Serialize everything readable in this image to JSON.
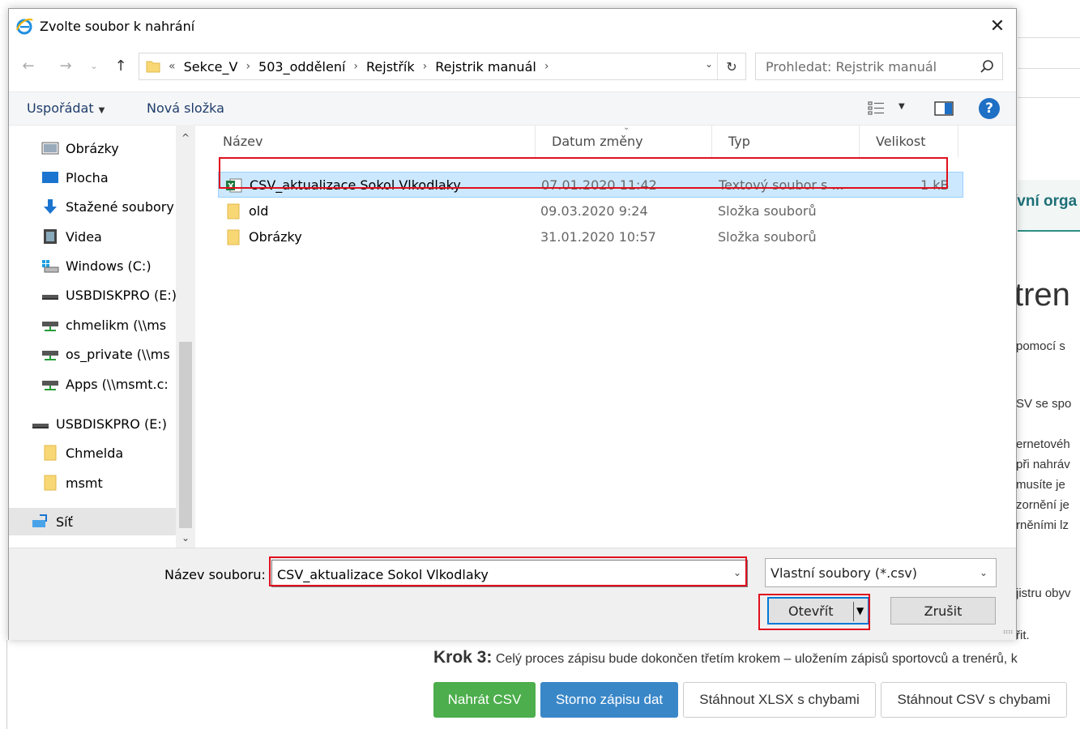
{
  "dialog": {
    "title": "Zvolte soubor k nahrání",
    "close": "✕",
    "breadcrumb": {
      "overflow": "«",
      "items": [
        "Sekce_V",
        "503_oddělení",
        "Rejstřík",
        "Rejstrik manuál"
      ]
    },
    "search_placeholder": "Prohledat: Rejstrik manuál",
    "toolbar": {
      "organize": "Uspořádat",
      "new_folder": "Nová složka"
    },
    "tree": [
      {
        "label": "Obrázky",
        "icon": "pictures-icon"
      },
      {
        "label": "Plocha",
        "icon": "desktop-icon"
      },
      {
        "label": "Stažené soubory",
        "icon": "download-icon"
      },
      {
        "label": "Videa",
        "icon": "video-icon"
      },
      {
        "label": "Windows (C:)",
        "icon": "windows-drive-icon"
      },
      {
        "label": "USBDISKPRO (E:)",
        "icon": "drive-icon"
      },
      {
        "label": "chmelikm (\\\\ms",
        "icon": "network-drive-icon"
      },
      {
        "label": "os_private (\\\\ms",
        "icon": "network-drive-icon"
      },
      {
        "label": "Apps (\\\\msmt.c:",
        "icon": "network-drive-icon"
      },
      {
        "label": "USBDISKPRO (E:)",
        "icon": "drive-icon"
      },
      {
        "label": "Chmelda",
        "icon": "folder-icon"
      },
      {
        "label": "msmt",
        "icon": "folder-icon"
      },
      {
        "label": "Síť",
        "icon": "network-icon"
      }
    ],
    "columns": {
      "name": "Název",
      "date": "Datum změny",
      "type": "Typ",
      "size": "Velikost"
    },
    "files": [
      {
        "name": "CSV_aktualizace Sokol Vlkodlaky",
        "date": "07.01.2020 11:42",
        "type": "Textový soubor s ...",
        "size": "1 kB",
        "icon": "excel-csv-icon"
      },
      {
        "name": "old",
        "date": "09.03.2020 9:24",
        "type": "Složka souborů",
        "size": "",
        "icon": "folder-icon"
      },
      {
        "name": "Obrázky",
        "date": "31.01.2020 10:57",
        "type": "Složka souborů",
        "size": "",
        "icon": "folder-icon"
      }
    ],
    "filename_label": "Název souboru:",
    "filename_value": "CSV_aktualizace Sokol Vlkodlaky",
    "filter_value": "Vlastní soubory (*.csv)",
    "open_button": "Otevřít",
    "cancel_button": "Zrušit"
  },
  "background": {
    "band_text": "ívní orga",
    "big_text": "tren",
    "fragments": [
      "pomocí s",
      "SV se spo",
      "ernetovéh",
      "při nahráv",
      "musíte je",
      "zornění je",
      "rněními lz",
      "jistru obyv",
      "řit."
    ],
    "step3_label": "Krok 3:",
    "step3_text": "Celý proces zápisu bude dokončen třetím krokem – uložením zápisů sportovců a trenérů, k",
    "buttons": {
      "upload_csv": "Nahrát CSV",
      "cancel_entry": "Storno zápisu dat",
      "download_xlsx": "Stáhnout XLSX s chybami",
      "download_csv": "Stáhnout CSV s chybami"
    }
  },
  "colors": {
    "highlight": "#e0101e",
    "selection": "#cce8ff",
    "accent_blue": "#0078d7",
    "button_green": "#4cae4c",
    "button_blue": "#3a87c8"
  }
}
